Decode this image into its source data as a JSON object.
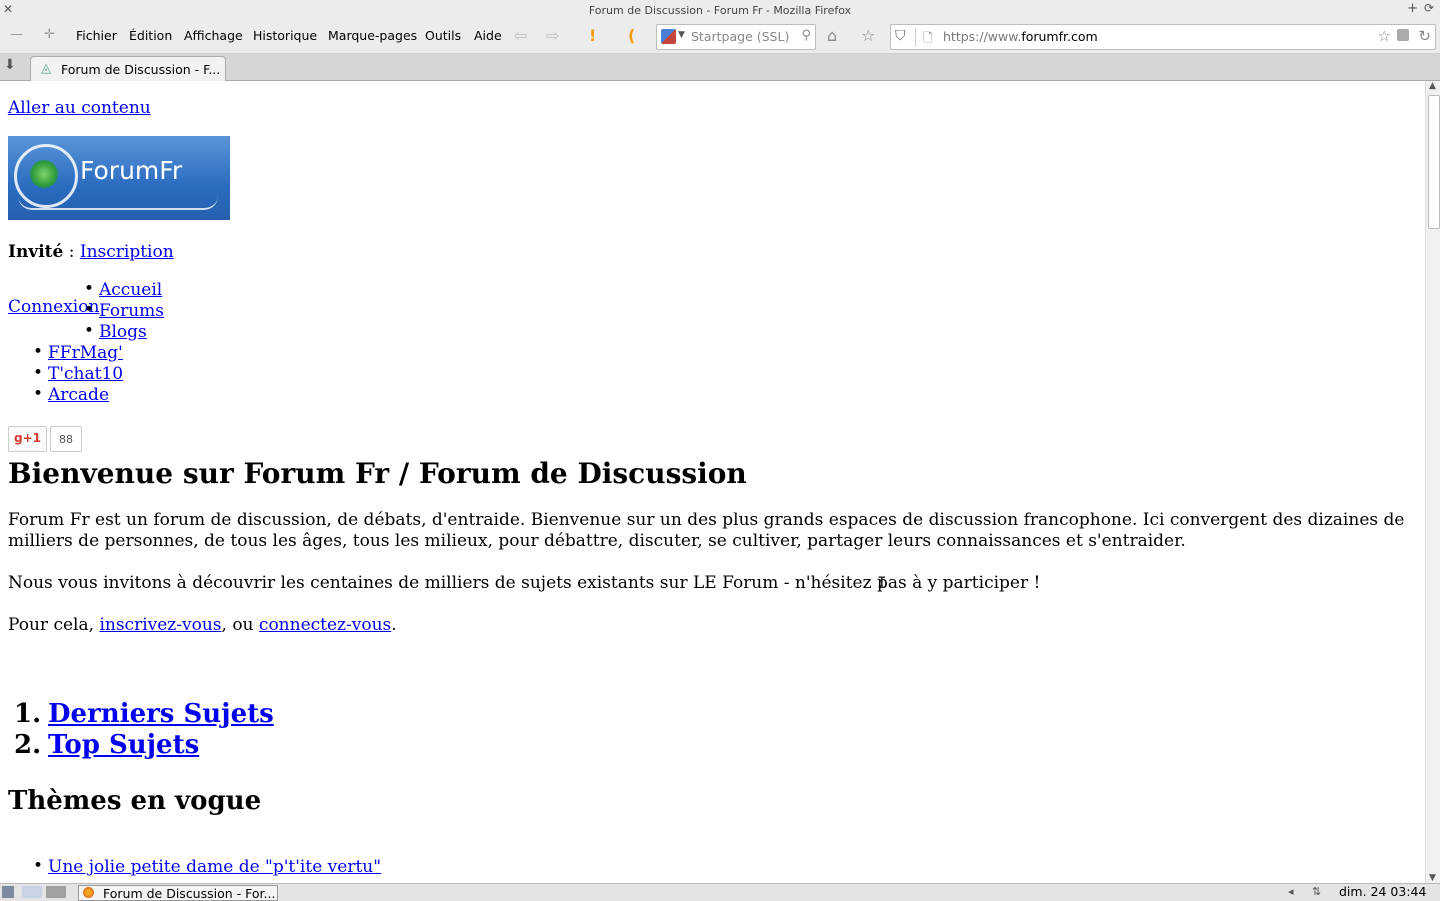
{
  "window": {
    "title": "Forum de Discussion - Forum Fr - Mozilla Firefox"
  },
  "menu": [
    "Fichier",
    "Édition",
    "Affichage",
    "Historique",
    "Marque-pages",
    "Outils",
    "Aide"
  ],
  "search": {
    "placeholder": "Startpage (SSL)"
  },
  "urlbar": {
    "prefix": "https://www.",
    "domain": "forumfr.com"
  },
  "tab": {
    "label": "Forum de Discussion - F..."
  },
  "page": {
    "skip_link": "Aller au contenu",
    "logo_text": "ForumFr",
    "user_label": "Invité",
    "user_sep": " : ",
    "inscription": "Inscription",
    "connexion": "Connexion",
    "nav_items": [
      "Accueil",
      "Forums",
      "Blogs",
      "FFrMag'",
      "T'chat10",
      "Arcade"
    ],
    "gplus_label": "g+1",
    "gplus_count": "88",
    "heading": "Bienvenue sur Forum Fr / Forum de Discussion",
    "para1_line1": "Forum Fr est un forum de discussion, de débats, d'entraide. Bienvenue sur un des plus grands espaces de discussion francophone. Ici convergent des dizaines de",
    "para1_line2": "milliers de personnes, de tous les âges, tous les milieux, pour débattre, discuter, se cultiver, partager leurs connaissances et s'entraider.",
    "para2": "Nous vous invitons à découvrir les centaines de milliers de sujets existants sur LE Forum - n'hésitez pas à y participer !",
    "para3_pre": "Pour cela, ",
    "para3_link1": "inscrivez-vous",
    "para3_mid": ", ou ",
    "para3_link2": "connectez-vous",
    "para3_end": ".",
    "ordered": [
      "Derniers Sujets",
      "Top Sujets"
    ],
    "themes_heading": "Thèmes en vogue",
    "themes": [
      "Une jolie petite dame de \"p't'ite vertu\""
    ]
  },
  "taskbar": {
    "window_label": "Forum de Discussion - For...",
    "clock": "dim. 24   03:44"
  }
}
